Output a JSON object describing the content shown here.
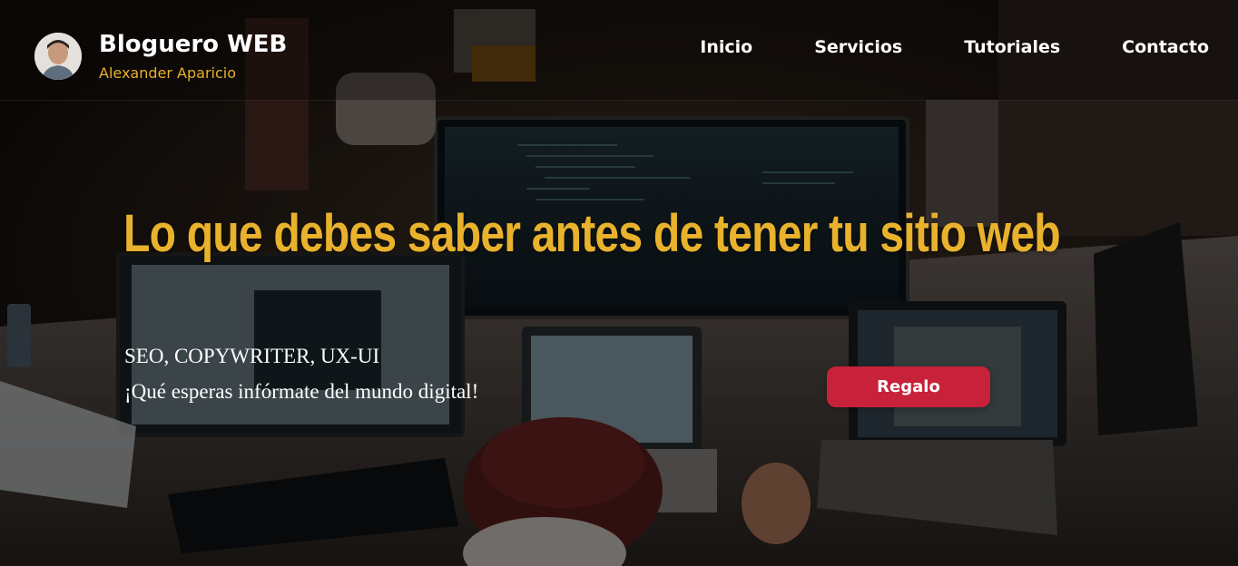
{
  "brand": {
    "title": "Bloguero WEB",
    "author": "Alexander Aparicio",
    "accent_color": "#e9b22c"
  },
  "nav": {
    "items": [
      {
        "label": "Inicio"
      },
      {
        "label": "Servicios"
      },
      {
        "label": "Tutoriales"
      },
      {
        "label": "Contacto"
      }
    ]
  },
  "hero": {
    "headline": "Lo que debes saber antes de tener tu sitio web",
    "tags": "SEO, COPYWRITER, UX-UI",
    "tagline": "¡Qué esperas infórmate del mundo digital!",
    "cta_label": "Regalo",
    "cta_color": "#c8223a",
    "background_icon": "office-desk-photo"
  }
}
